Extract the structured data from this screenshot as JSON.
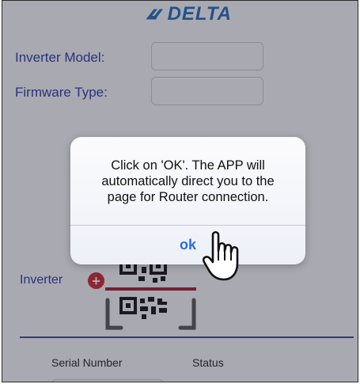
{
  "brand": {
    "logo_text": "DELTA",
    "color": "#1f6fbf"
  },
  "form": {
    "inverter_model_label": "Inverter Model:",
    "firmware_type_label": "Firmware Type:",
    "inverter_model_value": "",
    "firmware_type_value": ""
  },
  "inverter_section": {
    "label": "Inverter",
    "add_icon": "plus-circle-icon",
    "scan_icon": "qr-scan-icon"
  },
  "table": {
    "columns": [
      "Serial Number",
      "Status"
    ]
  },
  "dialog": {
    "message": "Click on 'OK'. The APP will automatically direct you to the page for Router connection.",
    "ok_label": "ok"
  },
  "colors": {
    "label_blue": "#2c3aa6",
    "add_red": "#d3262b",
    "ok_blue": "#2a6fd6"
  }
}
